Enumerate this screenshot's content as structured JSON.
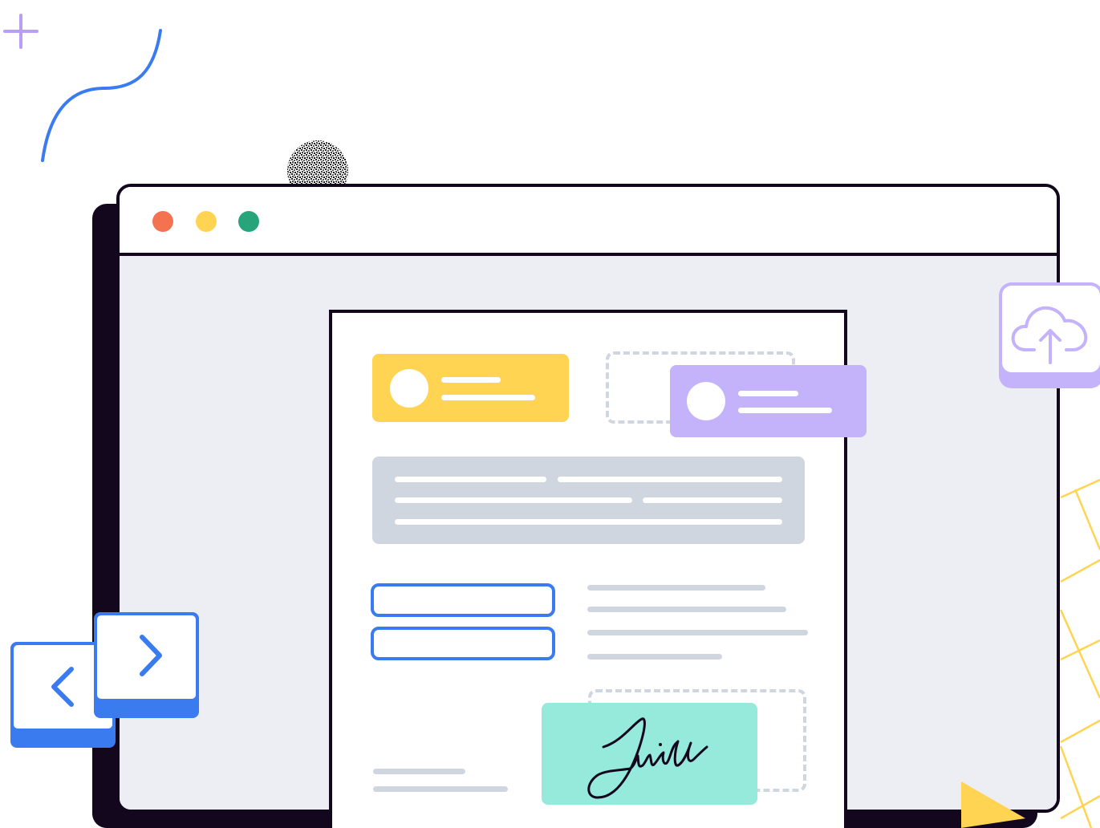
{
  "colors": {
    "ink": "#13071e",
    "window_background": "#eceef3",
    "close_dot": "#f4724f",
    "minimize_dot": "#ffd452",
    "maximize_dot": "#27a479",
    "yellow_card": "#ffd452",
    "purple_card": "#c4b2fa",
    "grey_block": "#d0d6df",
    "blue_accent": "#3a7bf0",
    "signature_card": "#95eadb",
    "plus_sign": "#b79ef7",
    "grid_lines": "#ffd452"
  },
  "icons": {
    "upload": "cloud-upload-icon",
    "previous": "chevron-left-icon",
    "next": "chevron-right-icon",
    "plus": "plus-icon",
    "play": "play-icon"
  },
  "signature": {
    "kind": "handwritten signature"
  }
}
